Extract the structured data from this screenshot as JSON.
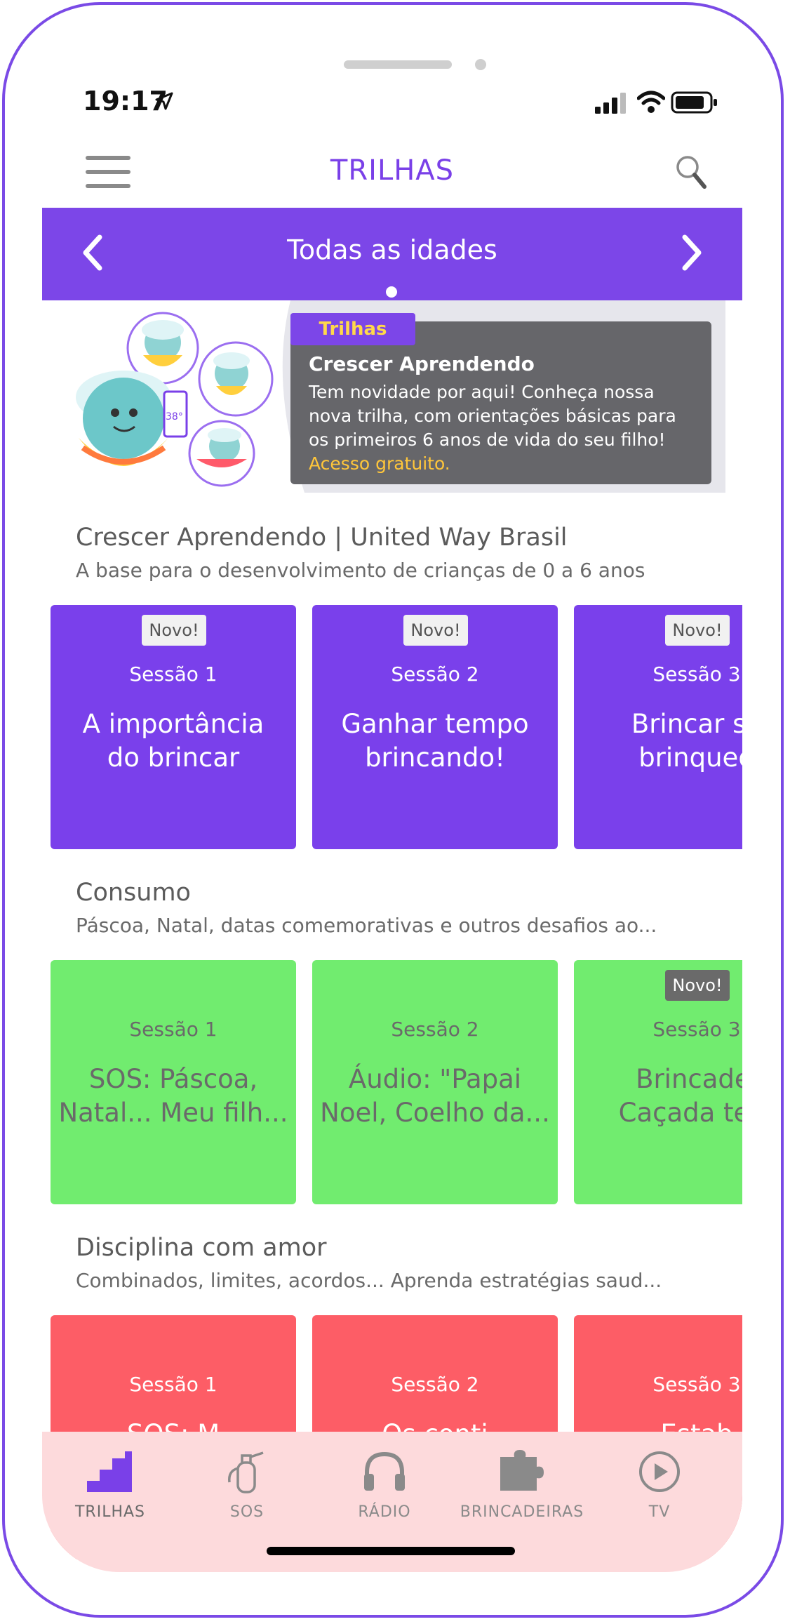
{
  "status": {
    "time": "19:17"
  },
  "header": {
    "title": "TRILHAS"
  },
  "age_selector": {
    "label": "Todas as idades"
  },
  "banner": {
    "tag": "Trilhas",
    "title": "Crescer Aprendendo",
    "text": "Tem novidade por aqui! Conheça nossa nova trilha, com orientações básicas para os primeiros 6 anos de vida do seu filho!",
    "link": "Acesso gratuito.",
    "art_text": "38°"
  },
  "sections": [
    {
      "title": "Crescer Aprendendo | United Way Brasil",
      "subtitle": "A base para o desenvolvimento de crianças de 0 a 6 anos",
      "tiles": [
        {
          "badge": "Novo!",
          "session": "Sessão 1",
          "title_line1": "A importância",
          "title_line2": "do brincar"
        },
        {
          "badge": "Novo!",
          "session": "Sessão 2",
          "title_line1": "Ganhar tempo",
          "title_line2": "brincando!"
        },
        {
          "badge": "Novo!",
          "session": "Sessão 3",
          "title_line1": "Brincar se",
          "title_line2": "brinqued"
        }
      ]
    },
    {
      "title": "Consumo",
      "subtitle": "Páscoa, Natal, datas comemorativas e outros desafios ao...",
      "tiles": [
        {
          "badge": "",
          "session": "Sessão 1",
          "title_line1": "SOS: Páscoa,",
          "title_line2": "Natal... Meu filh..."
        },
        {
          "badge": "",
          "session": "Sessão 2",
          "title_line1": "Áudio: \"Papai",
          "title_line2": "Noel, Coelho da..."
        },
        {
          "badge": "Novo!",
          "session": "Sessão 3",
          "title_line1": "Brincadei",
          "title_line2": "Caçada tem"
        }
      ]
    },
    {
      "title": "Disciplina com amor",
      "subtitle": "Combinados, limites, acordos... Aprenda estratégias saud...",
      "tiles": [
        {
          "badge": "",
          "session": "Sessão 1",
          "title_line1": "SOS: M",
          "title_line2": ""
        },
        {
          "badge": "",
          "session": "Sessão 2",
          "title_line1": "Os conti",
          "title_line2": ""
        },
        {
          "badge": "",
          "session": "Sessão 3",
          "title_line1": "Estab",
          "title_line2": ""
        }
      ]
    }
  ],
  "nav": [
    {
      "label": "TRILHAS",
      "icon": "stairs-icon",
      "active": true
    },
    {
      "label": "SOS",
      "icon": "fire-extinguisher-icon"
    },
    {
      "label": "RÁDIO",
      "icon": "headphones-icon"
    },
    {
      "label": "BRINCADEIRAS",
      "icon": "puzzle-icon"
    },
    {
      "label": "TV",
      "icon": "play-icon"
    }
  ],
  "colors": {
    "accent": "#7c46e8",
    "tile_purple": "#7a40eb",
    "tile_green": "#71ec6f",
    "tile_red": "#fd5d66",
    "nav_bg": "#fddadc",
    "banner_link": "#ffc63a"
  }
}
